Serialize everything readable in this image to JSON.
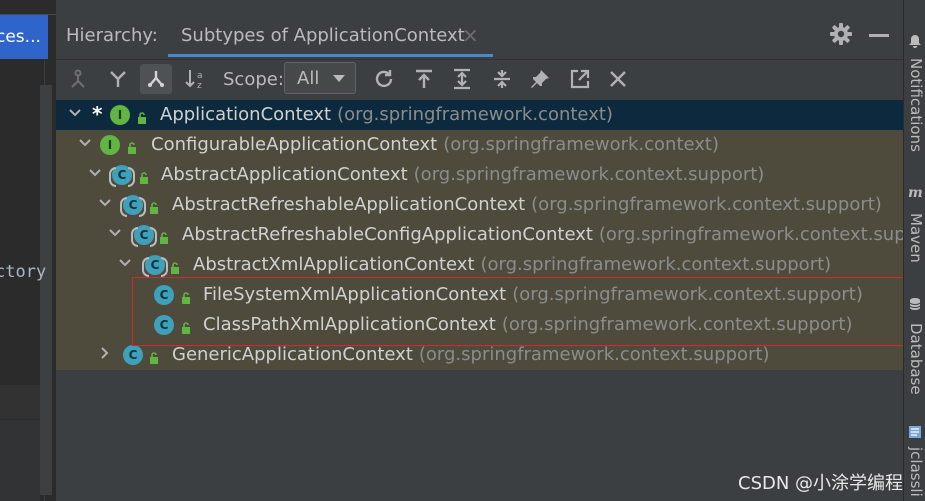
{
  "left_editor": {
    "tab_label": "ces...",
    "partial_code": "ctory"
  },
  "header": {
    "hierarchy_label": "Hierarchy:",
    "tab_title": "Subtypes of ApplicationContext",
    "tab_close": "×",
    "settings_icon": "gear-icon",
    "minimize_icon": "minimize-icon"
  },
  "toolbar": {
    "buttons": [
      "supertypes-hierarchy-icon",
      "merge-hierarchy-icon",
      "subtypes-hierarchy-icon",
      "sort-alphabetically-icon",
      "refresh-icon",
      "scroll-to-source-icon",
      "expand-all-icon",
      "collapse-all-icon",
      "pin-tab-icon",
      "export-icon",
      "close-icon"
    ],
    "scope_label": "Scope:",
    "scope_value": "All"
  },
  "tree": {
    "rows": [
      {
        "name": "ApplicationContext",
        "package": "(org.springframework.context)",
        "kind": "interface",
        "star": "*",
        "expanded": true,
        "selected": true
      },
      {
        "name": "ConfigurableApplicationContext",
        "package": "(org.springframework.context)",
        "kind": "interface",
        "expanded": true
      },
      {
        "name": "AbstractApplicationContext",
        "package": "(org.springframework.context.support)",
        "kind": "abstract-class",
        "expanded": true
      },
      {
        "name": "AbstractRefreshableApplicationContext",
        "package": "(org.springframework.context.support)",
        "kind": "abstract-class",
        "expanded": true
      },
      {
        "name": "AbstractRefreshableConfigApplicationContext",
        "package": "(org.springframework.context.suppo",
        "kind": "abstract-class",
        "expanded": true
      },
      {
        "name": "AbstractXmlApplicationContext",
        "package": "(org.springframework.context.support)",
        "kind": "abstract-class",
        "expanded": true
      },
      {
        "name": "FileSystemXmlApplicationContext",
        "package": "(org.springframework.context.support)",
        "kind": "class"
      },
      {
        "name": "ClassPathXmlApplicationContext",
        "package": "(org.springframework.context.support)",
        "kind": "class"
      },
      {
        "name": "GenericApplicationContext",
        "package": "(org.springframework.context.support)",
        "kind": "class",
        "expanded": false
      }
    ]
  },
  "right_stripe": {
    "notifications": "Notifications",
    "maven": "Maven",
    "database": "Database",
    "jclasslib": "jclassli"
  },
  "watermark": "CSDN @小涂学编程",
  "colors": {
    "panel_bg": "#3c3f41",
    "row_bg": "#4e4b3c",
    "selected_row_bg": "#0d293e",
    "interface_badge": "#62b543",
    "class_badge": "#3fa1b9",
    "highlight_border": "#d02a2a",
    "accent": "#4a88c7"
  }
}
